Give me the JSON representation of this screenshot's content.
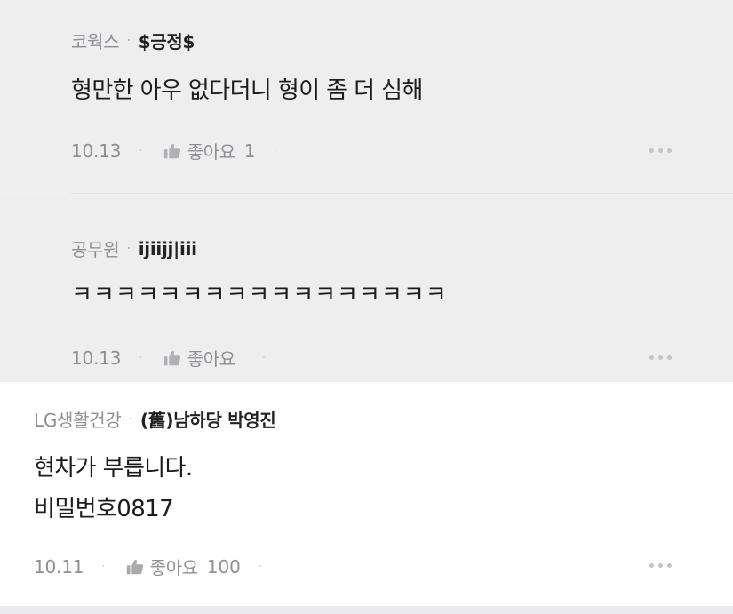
{
  "replies": [
    {
      "company": "코웍스",
      "separator": "·",
      "nickname": "$긍정$",
      "body": "형만한 아우 없다더니 형이 좀 더 심해",
      "date": "10.13",
      "like_label": "좋아요",
      "like_count": "1"
    },
    {
      "company": "공무원",
      "separator": "·",
      "nickname": "ijiijj|iii",
      "body": "ㅋㅋㅋㅋㅋㅋㅋㅋㅋㅋㅋㅋㅋㅋㅋㅋㅋ",
      "date": "10.13",
      "like_label": "좋아요",
      "like_count": ""
    }
  ],
  "comment": {
    "company": "LG생활건강",
    "separator": "·",
    "nickname": "(舊)남하당 박영진",
    "body_lines": [
      "현차가 부릅니다.",
      "비밀번호0817"
    ],
    "date": "10.11",
    "like_label": "좋아요",
    "like_count": "100"
  },
  "dot": "·",
  "icons": {
    "like": "thumbs-up-icon",
    "more": "more-horizontal-icon"
  },
  "colors": {
    "reply_background": "#eeeeef",
    "comment_background": "#ffffff",
    "meta_gray": "#8e8e93",
    "text_dark": "#1c1c1e"
  }
}
